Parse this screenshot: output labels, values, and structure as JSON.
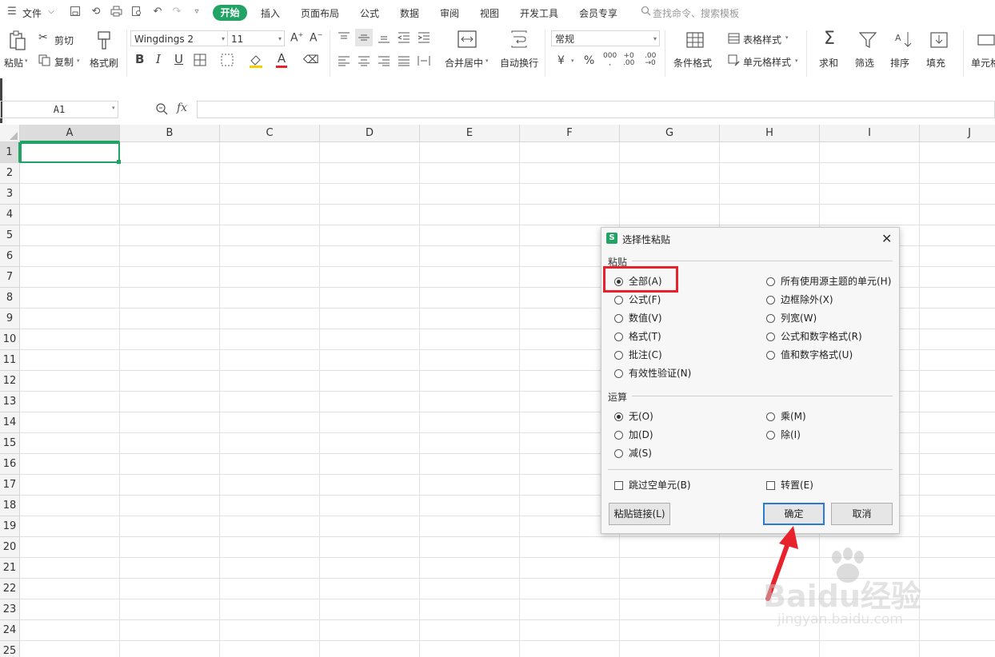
{
  "menubar": {
    "file": "文件",
    "tabs": [
      "开始",
      "插入",
      "页面布局",
      "公式",
      "数据",
      "审阅",
      "视图",
      "开发工具",
      "会员专享"
    ],
    "search_placeholder": "查找命令、搜索模板"
  },
  "ribbon": {
    "paste": "粘贴",
    "cut": "剪切",
    "copy": "复制",
    "format_painter": "格式刷",
    "font_name": "Wingdings 2",
    "font_size": "11",
    "merge_center": "合并居中",
    "wrap_text": "自动换行",
    "number_format": "常规",
    "conditional_format": "条件格式",
    "table_style": "表格样式",
    "cell_style": "单元格样式",
    "sum": "求和",
    "filter": "筛选",
    "sort": "排序",
    "fill": "填充",
    "cell": "单元格",
    "bold": "B",
    "italic": "I",
    "underline": "U",
    "font_color_letter": "A",
    "currency": "¥",
    "percent": "%"
  },
  "formula_bar": {
    "cell_ref": "A1",
    "fx": "fx",
    "value": ""
  },
  "grid": {
    "columns": [
      "A",
      "B",
      "C",
      "D",
      "E",
      "F",
      "G",
      "H",
      "I",
      "J"
    ],
    "rows": [
      "1",
      "2",
      "3",
      "4",
      "5",
      "6",
      "7",
      "8",
      "9",
      "10",
      "11",
      "12",
      "13",
      "14",
      "15",
      "16",
      "17",
      "18",
      "19",
      "20",
      "21",
      "22",
      "23",
      "24",
      "25"
    ]
  },
  "dialog": {
    "title": "选择性粘贴",
    "icon_letter": "S",
    "paste_section": "粘贴",
    "paste_left": [
      "全部(A)",
      "公式(F)",
      "数值(V)",
      "格式(T)",
      "批注(C)",
      "有效性验证(N)"
    ],
    "paste_right": [
      "所有使用源主题的单元(H)",
      "边框除外(X)",
      "列宽(W)",
      "公式和数字格式(R)",
      "值和数字格式(U)"
    ],
    "operation_section": "运算",
    "op_left": [
      "无(O)",
      "加(D)",
      "减(S)"
    ],
    "op_right": [
      "乘(M)",
      "除(I)"
    ],
    "skip_blanks": "跳过空单元(B)",
    "transpose": "转置(E)",
    "paste_link": "粘贴链接(L)",
    "ok": "确定",
    "cancel": "取消",
    "selected_paste": "全部(A)",
    "selected_operation": "无(O)"
  },
  "watermark": {
    "brand": "Baidu经验",
    "url": "jingyan.baidu.com"
  },
  "colors": {
    "accent": "#21a366",
    "highlight": "#e8222c"
  }
}
